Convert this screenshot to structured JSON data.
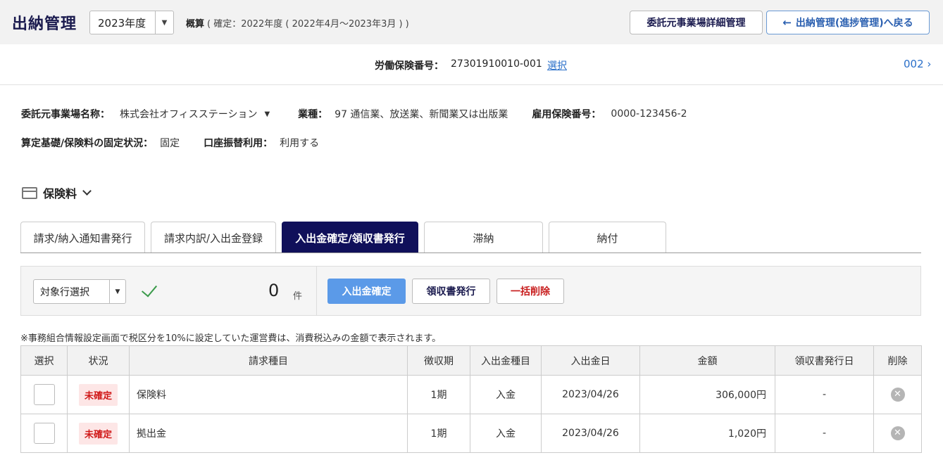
{
  "header": {
    "title": "出納管理",
    "year": "2023年度",
    "summary_label": "概算",
    "summary_text": "( 確定：2022年度 ( 2022年4月〜2023年3月 ) )",
    "detail_button": "委託元事業場詳細管理",
    "back_button": "出納管理(進捗管理)へ戻る"
  },
  "insurance": {
    "label": "労働保険番号：",
    "number": "27301910010-001",
    "select_link": "選択",
    "pager": "002"
  },
  "info": {
    "company_label": "委託元事業場名称：",
    "company": "株式会社オフィスステーション",
    "industry_label": "業種：",
    "industry": "97 通信業、放送業、新聞業又は出版業",
    "employment_label": "雇用保険番号：",
    "employment": "0000-123456-2",
    "basis_label": "算定基礎/保険料の固定状況：",
    "basis": "固定",
    "transfer_label": "口座振替利用：",
    "transfer": "利用する"
  },
  "section": {
    "title": "保険料"
  },
  "tabs": [
    {
      "label": "請求/納入通知書発行"
    },
    {
      "label": "請求内訳/入出金登録"
    },
    {
      "label": "入出金確定/領収書発行"
    },
    {
      "label": "滞納"
    },
    {
      "label": "納付"
    }
  ],
  "actions": {
    "target_select": "対象行選択",
    "count": "0",
    "count_unit": "件",
    "confirm": "入出金確定",
    "receipt": "領収書発行",
    "bulk_delete": "一括削除"
  },
  "note": "※事務組合情報設定画面で税区分を10%に設定していた運営費は、消費税込みの金額で表示されます。",
  "table": {
    "headers": [
      "選択",
      "状況",
      "請求種目",
      "徴収期",
      "入出金種目",
      "入出金日",
      "金額",
      "領収書発行日",
      "削除"
    ],
    "rows": [
      {
        "status": "未確定",
        "item": "保険料",
        "period": "1期",
        "type": "入金",
        "date": "2023/04/26",
        "amount": "306,000円",
        "receipt_date": "-"
      },
      {
        "status": "未確定",
        "item": "拠出金",
        "period": "1期",
        "type": "入金",
        "date": "2023/04/26",
        "amount": "1,020円",
        "receipt_date": "-"
      }
    ]
  },
  "colors": {
    "primary": "#10105a",
    "accent": "#5b9ae8",
    "danger": "#c81e1e"
  }
}
